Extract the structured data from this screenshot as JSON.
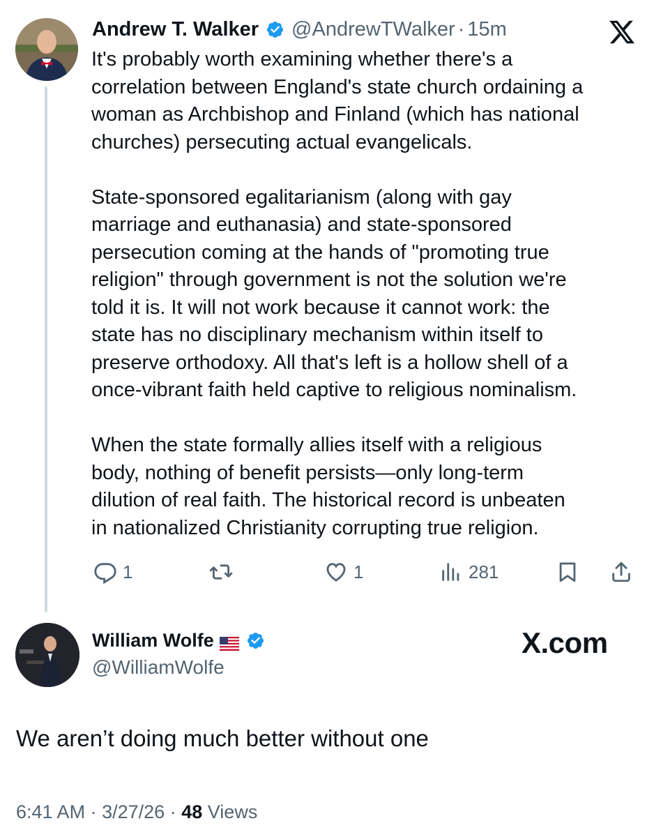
{
  "quoted_tweet": {
    "author_name": "Andrew T. Walker",
    "handle": "@AndrewTWalker",
    "separator": "·",
    "time": "15m",
    "paragraphs": [
      [
        "It's probably worth examining whether there's a",
        "correlation between England's state church ordaining a",
        "woman as Archbishop and Finland (which has national",
        "churches) persecuting actual evangelicals."
      ],
      [
        "State-sponsored egalitarianism (along with gay",
        "marriage and euthanasia) and state-sponsored",
        "persecution coming at the hands of \"promoting true",
        "religion\" through government is not the solution we're",
        "told it is. It will not work because it cannot work: the",
        "state has no disciplinary mechanism within itself to",
        "preserve orthodoxy. All that's left is a hollow shell of a",
        "once-vibrant faith held captive to religious nominalism."
      ],
      [
        "When the state formally allies itself with a religious",
        "body, nothing of benefit persists—only long-term",
        "dilution of real faith. The historical record is unbeaten",
        "in nationalized Christianity corrupting true religion."
      ]
    ],
    "actions": {
      "reply_count": "1",
      "retweet_count": "",
      "like_count": "1",
      "views_count": "281"
    }
  },
  "main_tweet": {
    "author_name": "William Wolfe",
    "handle": "@WilliamWolfe",
    "text": "We aren’t doing much better without one",
    "time": "6:41 AM",
    "date": "3/27/26",
    "separator": "·",
    "views_count": "48",
    "views_label": "Views"
  },
  "watermark": "X.com",
  "icons": {
    "x_logo": "x-logo-icon",
    "verified": "verified-badge-icon",
    "flag": "us-flag-icon",
    "reply": "reply-icon",
    "retweet": "retweet-icon",
    "like": "heart-icon",
    "views": "views-chart-icon",
    "bookmark": "bookmark-icon",
    "share": "share-icon"
  },
  "colors": {
    "text": "#0f1419",
    "secondary": "#536471",
    "verified": "#1d9bf0",
    "thread_line": "#cfd9de"
  }
}
